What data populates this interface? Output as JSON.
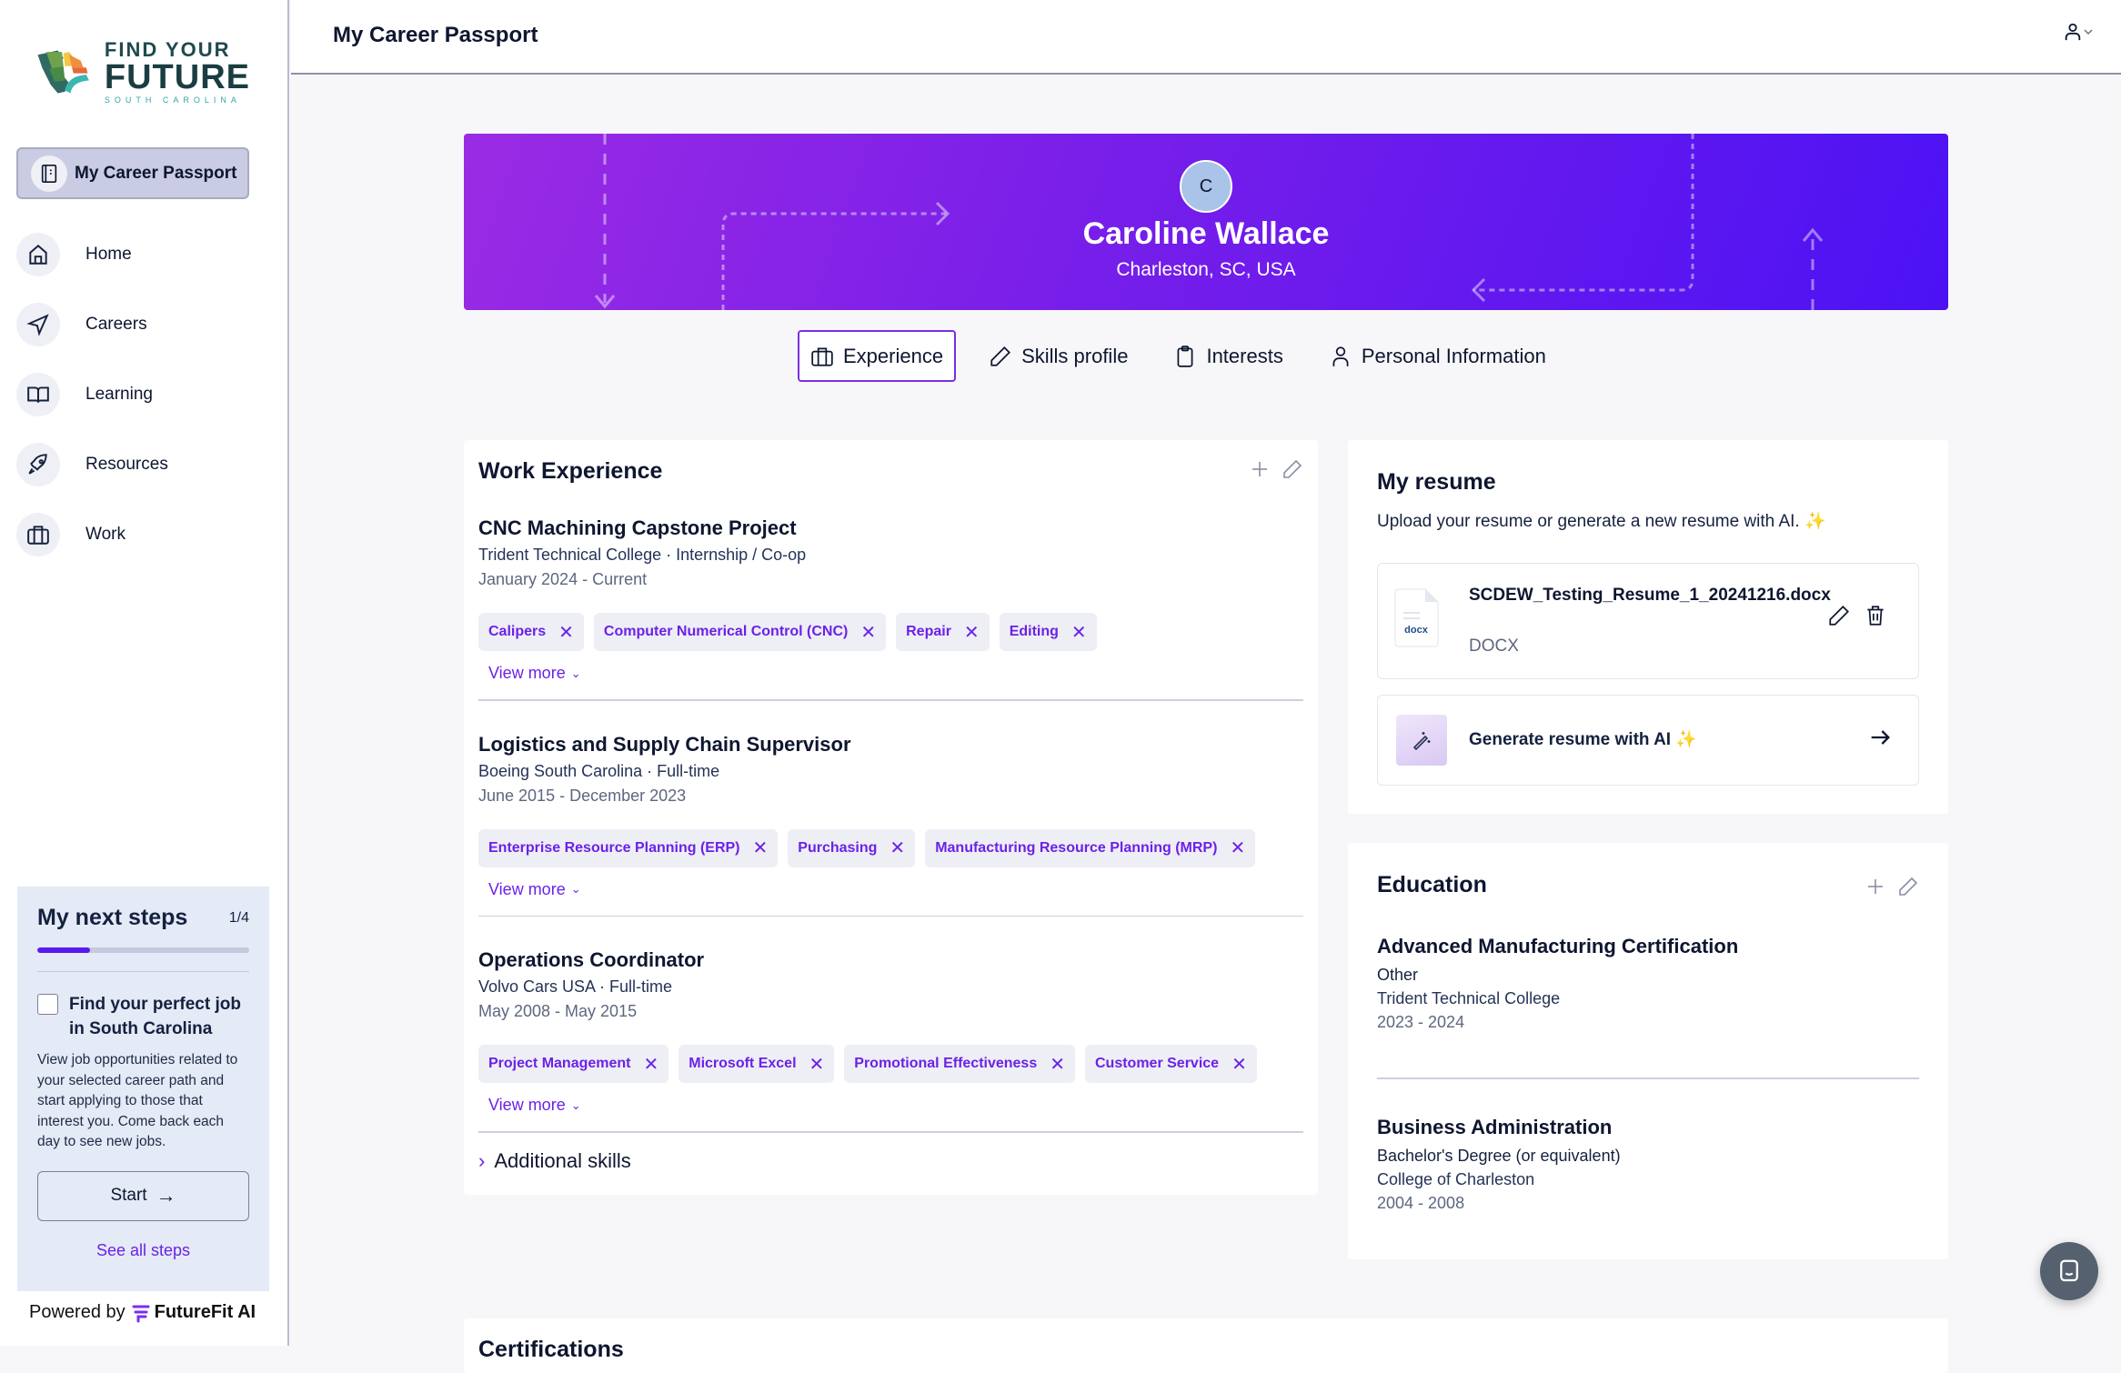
{
  "sidebar": {
    "logo": {
      "line1": "FIND YOUR",
      "line2": "FUTURE",
      "line3": "SOUTH CAROLINA"
    },
    "active_item": {
      "label": "My Career Passport",
      "icon": "passport-icon"
    },
    "items": [
      {
        "label": "Home",
        "icon": "home-icon"
      },
      {
        "label": "Careers",
        "icon": "navigation-arrow-icon"
      },
      {
        "label": "Learning",
        "icon": "book-icon"
      },
      {
        "label": "Resources",
        "icon": "rocket-icon"
      },
      {
        "label": "Work",
        "icon": "briefcase-icon"
      }
    ],
    "next_steps": {
      "title": "My next steps",
      "count": "1/4",
      "progress_fraction": 0.25,
      "step_title": "Find your perfect job in South Carolina",
      "step_checked": false,
      "step_description": "View job opportunities related to your selected career path and start applying to those that interest you. Come back each day to see new jobs.",
      "start_label": "Start",
      "see_all_label": "See all steps"
    },
    "powered_by": {
      "prefix": "Powered by",
      "brand": "FutureFit AI"
    }
  },
  "header": {
    "title": "My Career Passport",
    "user_menu_icon": "user-icon"
  },
  "profile": {
    "avatar_initial": "C",
    "name": "Caroline Wallace",
    "location": "Charleston, SC, USA"
  },
  "tabs": [
    {
      "label": "Experience",
      "icon": "briefcase-icon",
      "active": true
    },
    {
      "label": "Skills profile",
      "icon": "pencil-icon",
      "active": false
    },
    {
      "label": "Interests",
      "icon": "clipboard-icon",
      "active": false
    },
    {
      "label": "Personal Information",
      "icon": "user-icon",
      "active": false
    }
  ],
  "work_experience": {
    "title": "Work Experience",
    "jobs": [
      {
        "title": "CNC Machining Capstone Project",
        "subtitle": "Trident Technical College · Internship / Co-op",
        "dates": "January 2024 - Current",
        "skills": [
          "Calipers",
          "Computer Numerical Control (CNC)",
          "Repair",
          "Editing"
        ],
        "view_more": "View more"
      },
      {
        "title": "Logistics and Supply Chain Supervisor",
        "subtitle": "Boeing South Carolina · Full-time",
        "dates": "June 2015 - December 2023",
        "skills": [
          "Enterprise Resource Planning (ERP)",
          "Purchasing",
          "Manufacturing Resource Planning (MRP)"
        ],
        "view_more": "View more"
      },
      {
        "title": "Operations Coordinator",
        "subtitle": "Volvo Cars USA · Full-time",
        "dates": "May 2008 - May 2015",
        "skills": [
          "Project Management",
          "Microsoft Excel",
          "Promotional Effectiveness",
          "Customer Service"
        ],
        "view_more": "View more"
      }
    ],
    "additional_skills_label": "Additional skills"
  },
  "resume": {
    "title": "My resume",
    "subtitle": "Upload your resume or generate a new resume with AI. ✨",
    "file_name": "SCDEW_Testing_Resume_1_20241216.docx",
    "file_icon_label": "docx",
    "file_type": "DOCX",
    "generate_label": "Generate resume with AI ✨"
  },
  "education": {
    "title": "Education",
    "items": [
      {
        "title": "Advanced Manufacturing Certification",
        "type": "Other",
        "school": "Trident Technical College",
        "years": "2023 - 2024"
      },
      {
        "title": "Business Administration",
        "type": "Bachelor's Degree (or equivalent)",
        "school": "College of Charleston",
        "years": "2004 - 2008"
      }
    ]
  },
  "certifications": {
    "title": "Certifications"
  },
  "colors": {
    "accent": "#6a22e8",
    "banner_start": "#9a2be4",
    "banner_end": "#4c12f4",
    "chip_bg": "#eeeef5"
  }
}
